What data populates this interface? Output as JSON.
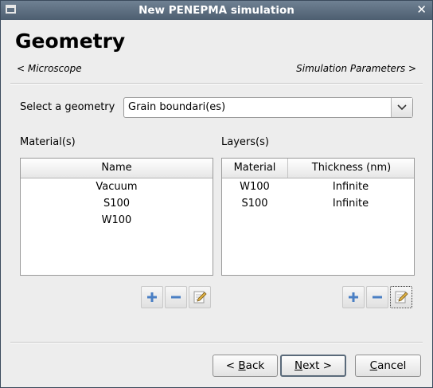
{
  "window": {
    "title": "New PENEPMA simulation",
    "close_glyph": "✕"
  },
  "page": {
    "heading": "Geometry",
    "prev_link": "< Microscope",
    "next_link": "Simulation Parameters >"
  },
  "geometry": {
    "label": "Select a geometry",
    "selected": "Grain boundari(es)"
  },
  "materials": {
    "label": "Material(s)",
    "column": "Name",
    "rows": [
      "Vacuum",
      "S100",
      "W100"
    ]
  },
  "layers": {
    "label": "Layers(s)",
    "columns": [
      "Material",
      "Thickness (nm)"
    ],
    "rows": [
      {
        "material": "W100",
        "thickness": "Infinite"
      },
      {
        "material": "S100",
        "thickness": "Infinite"
      }
    ]
  },
  "buttons": {
    "back_pre": "< ",
    "back_key": "B",
    "back_rest": "ack",
    "next_key": "N",
    "next_rest": "ext >",
    "cancel_key": "C",
    "cancel_rest": "ancel"
  },
  "icons": {
    "add": "plus-icon",
    "remove": "minus-icon",
    "edit": "edit-icon",
    "add_color": "#4a7fc4",
    "remove_color": "#4a7fc4"
  }
}
